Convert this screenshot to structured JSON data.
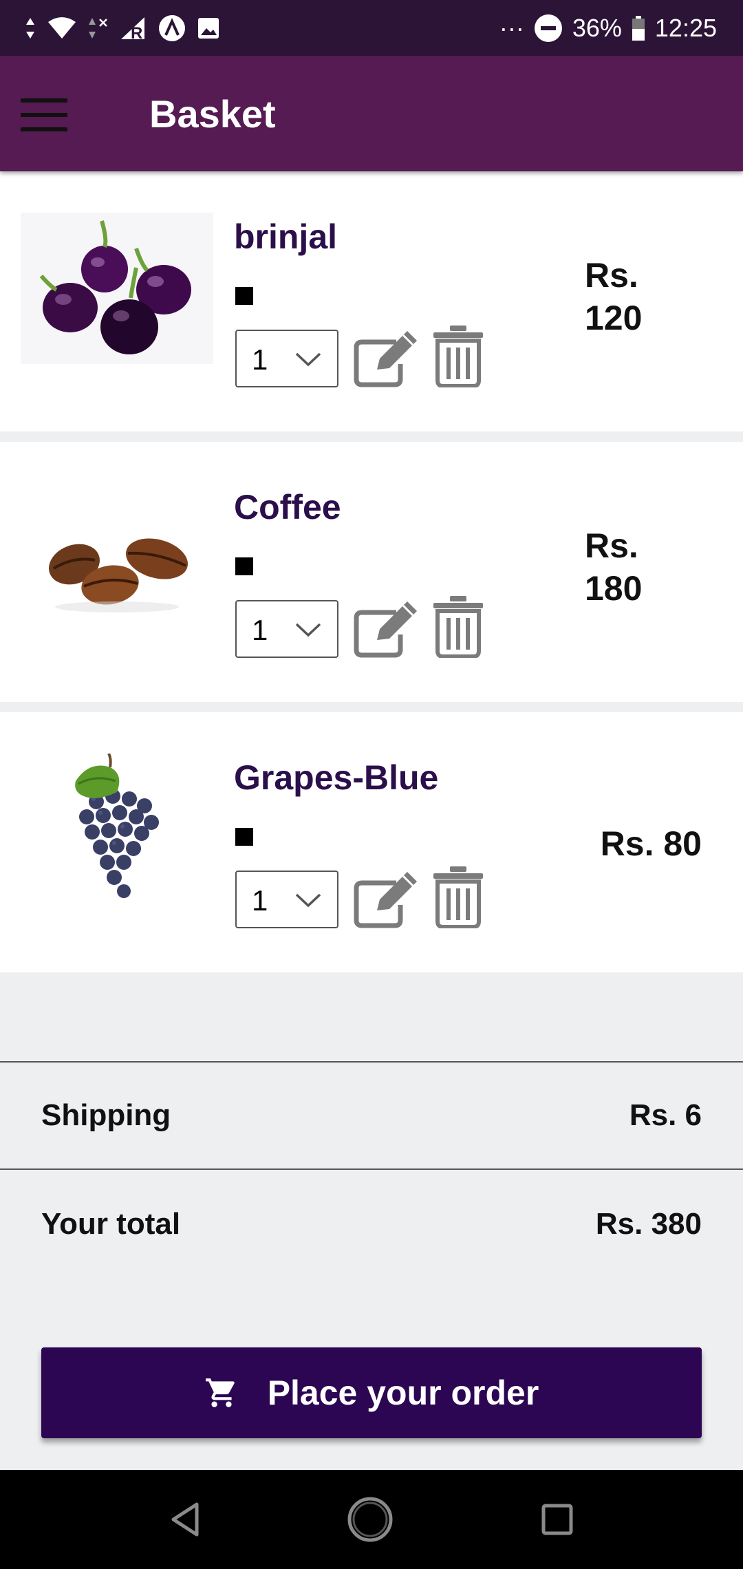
{
  "status_bar": {
    "battery": "36%",
    "time": "12:25",
    "more": "···"
  },
  "header": {
    "title": "Basket",
    "menu_icon": "hamburger-menu-icon"
  },
  "items": [
    {
      "name": "brinjal",
      "quantity": "1",
      "price": "Rs. 120",
      "image": "eggplant-photo"
    },
    {
      "name": "Coffee",
      "quantity": "1",
      "price": "Rs. 180",
      "image": "coffee-beans-photo"
    },
    {
      "name": "Grapes-Blue",
      "quantity": "1",
      "price": "Rs. 80",
      "image": "blue-grapes-photo"
    }
  ],
  "summary": {
    "shipping_label": "Shipping",
    "shipping_value": "Rs. 6",
    "total_label": "Your total",
    "total_value": "Rs. 380"
  },
  "order_button": {
    "label": "Place your order",
    "icon": "cart-icon"
  },
  "colors": {
    "app_bar": "#561b53",
    "status_bar": "#2c1437",
    "item_name": "#2b0f4b",
    "order_button": "#2c0653"
  }
}
